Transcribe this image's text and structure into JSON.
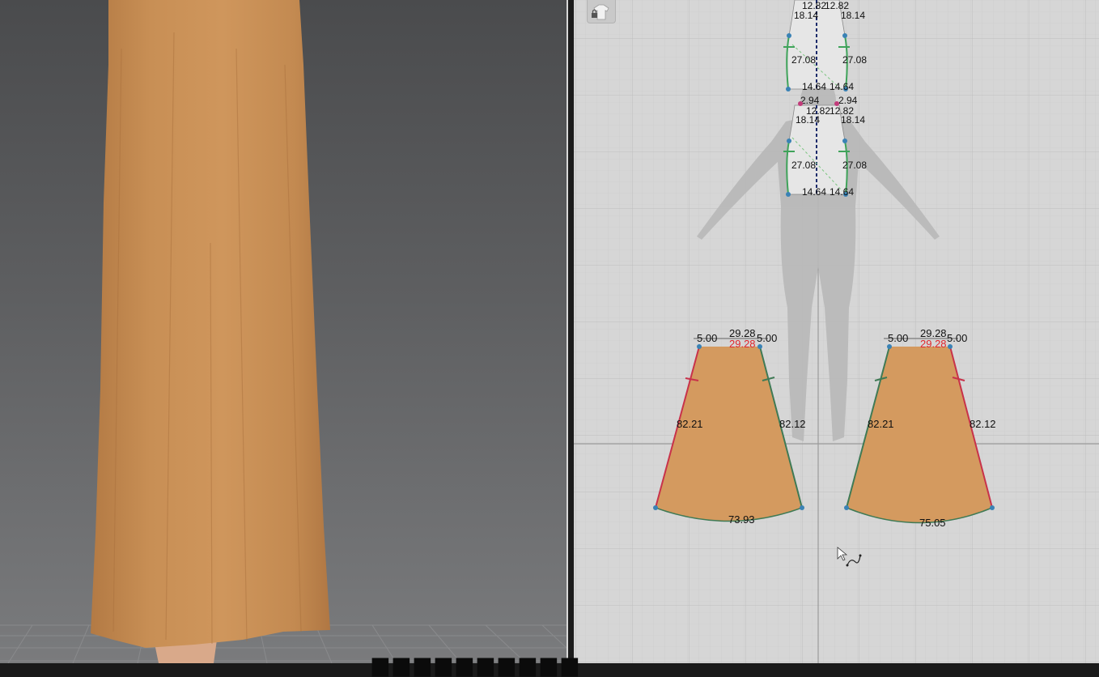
{
  "viewport_3d": {
    "garment_color": "#c88f55",
    "background_top": "#4a4b4d",
    "background_bottom": "#7a7b7d"
  },
  "viewport_2d": {
    "lock_button": {
      "icon": "lock-icon"
    },
    "bodice_front": {
      "labels": [
        "12.82",
        "12.82",
        "18.14",
        "18.14",
        "27.08",
        "27.08",
        "14.64",
        "14.64",
        "2.94",
        "2.94"
      ]
    },
    "bodice_back": {
      "labels": [
        "12.82",
        "12.82",
        "18.14",
        "18.14",
        "27.08",
        "27.08",
        "14.64",
        "14.64"
      ]
    },
    "skirt_left": {
      "fill": "#d49a5f",
      "top_dart_left": "5.00",
      "top_dart_right": "5.00",
      "top_length": "29.28",
      "top_length_red": "29.28",
      "left_side": "82.21",
      "right_side": "82.12",
      "hem": "73.93"
    },
    "skirt_right": {
      "fill": "#d49a5f",
      "top_dart_left": "5.00",
      "top_dart_right": "5.00",
      "top_length": "29.28",
      "top_length_red": "29.28",
      "left_side": "82.21",
      "right_side": "82.12",
      "hem": "75.05"
    },
    "cursor": "segment-tool-cursor-icon"
  },
  "caption": {
    "text": "▆▆▆▆▆▆▆▆▆▆"
  }
}
